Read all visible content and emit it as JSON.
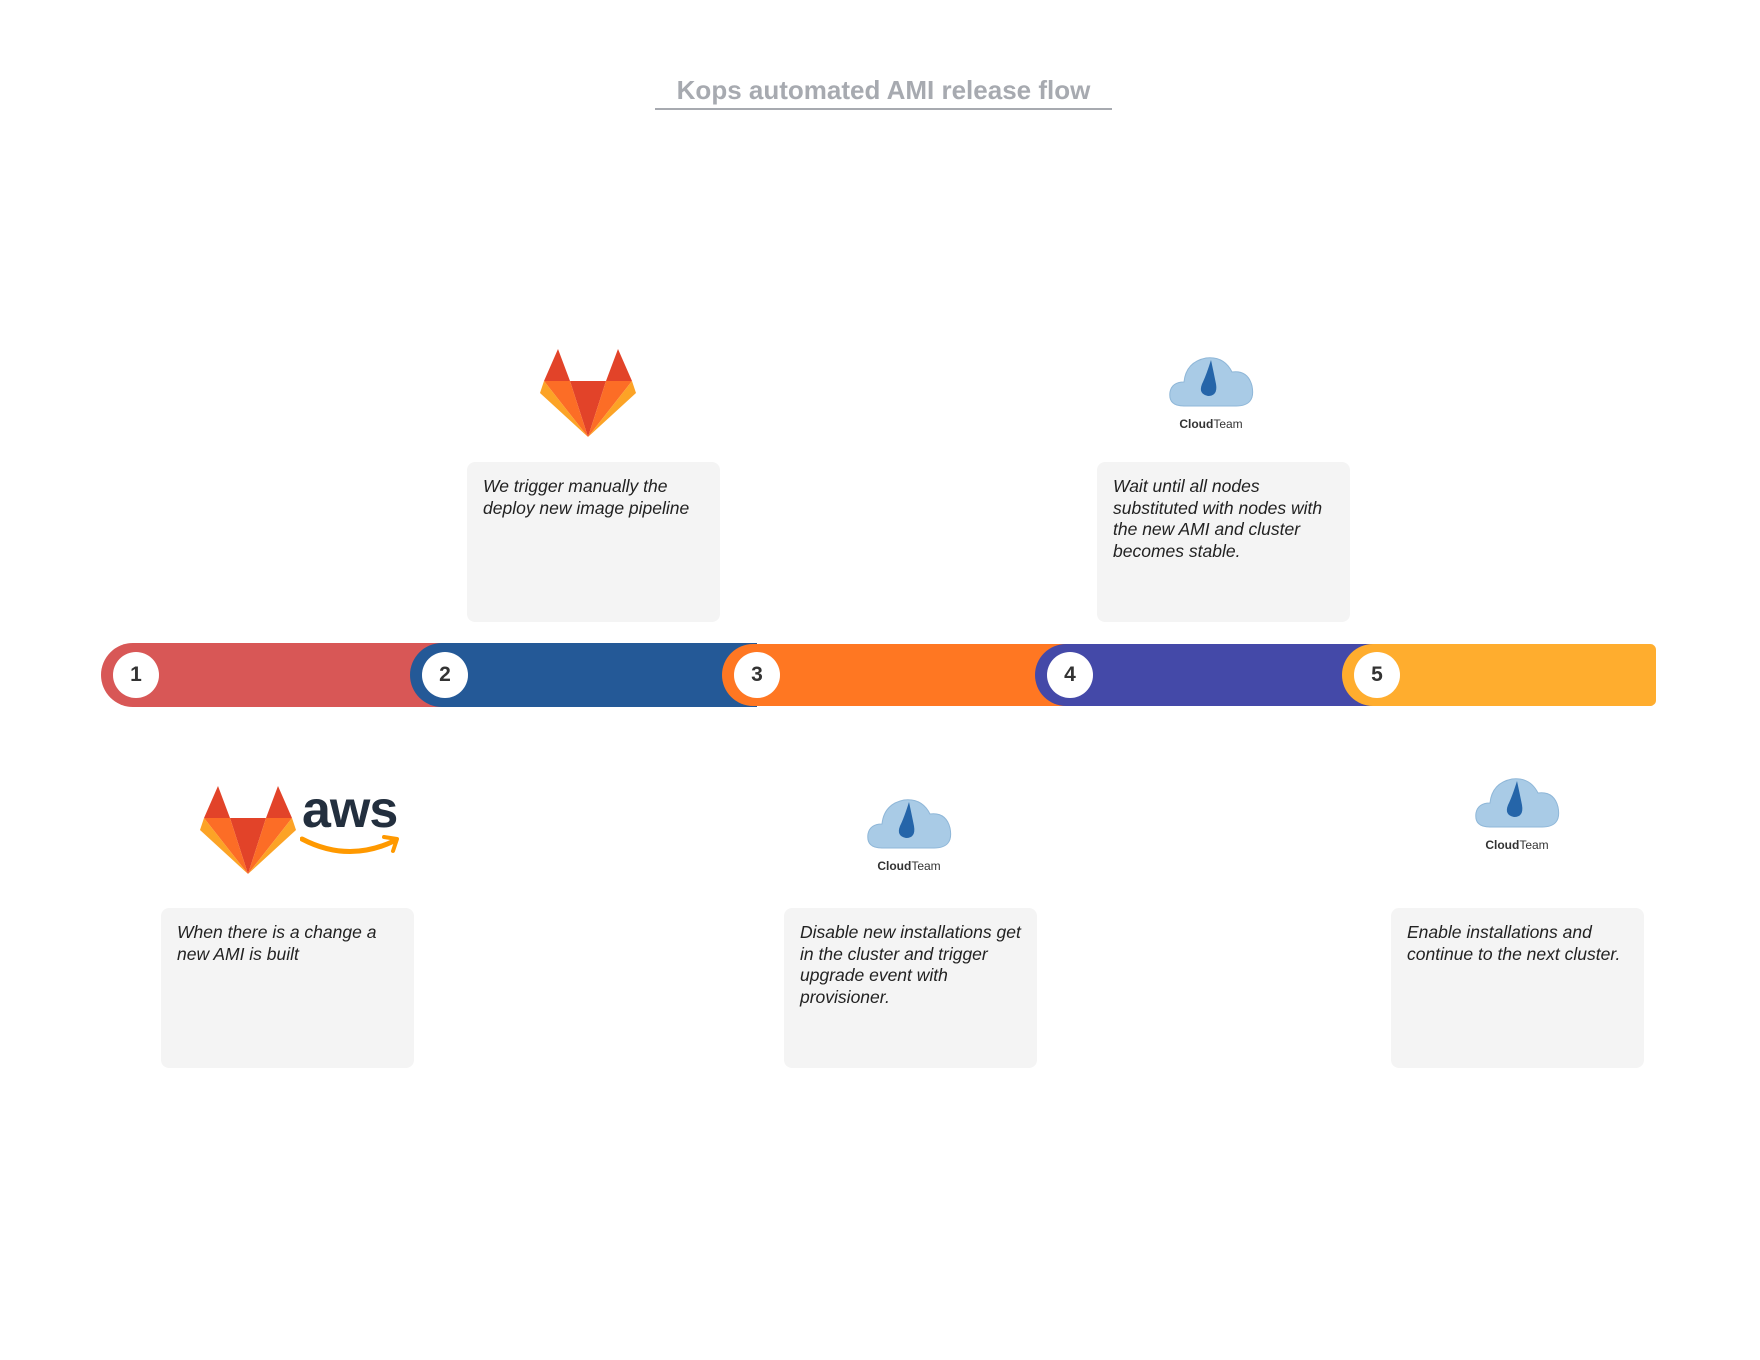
{
  "title": "Kops automated AMI release flow",
  "colors": {
    "step1": "#d85756",
    "step2": "#245997",
    "step3": "#ff7722",
    "step4": "#4449a8",
    "step5": "#ffad2e",
    "card_bg": "#f4f4f4",
    "title": "#a7aab0"
  },
  "steps": [
    {
      "number": "1",
      "description": "When there is a change a new AMI is built",
      "logos": [
        "gitlab-logo",
        "aws-logo"
      ]
    },
    {
      "number": "2",
      "description": "We trigger manually the deploy new image pipeline",
      "logos": [
        "gitlab-logo"
      ]
    },
    {
      "number": "3",
      "description": "Disable new installations get in the cluster and trigger upgrade event with provisioner.",
      "logos": [
        "cloudteam-logo"
      ]
    },
    {
      "number": "4",
      "description": "Wait until all nodes substituted with nodes with the new AMI and cluster becomes stable.",
      "logos": [
        "cloudteam-logo"
      ]
    },
    {
      "number": "5",
      "description": "Enable installations and continue to the next cluster.",
      "logos": [
        "cloudteam-logo"
      ]
    }
  ],
  "logo_text": {
    "aws": "aws",
    "cloudteam_bold": "Cloud",
    "cloudteam_regular": "Team"
  }
}
